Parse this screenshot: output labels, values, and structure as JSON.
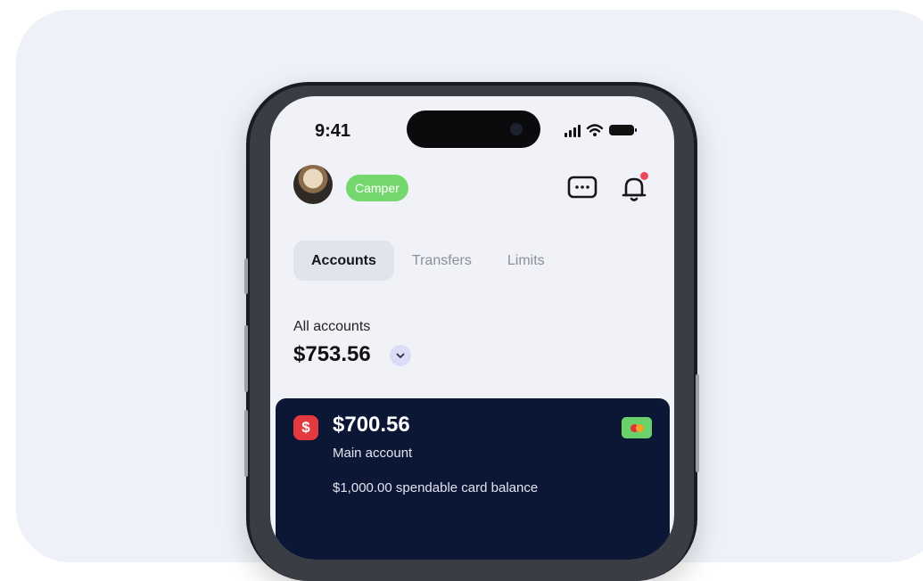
{
  "status_bar": {
    "time": "9:41"
  },
  "header": {
    "badge_label": "Camper"
  },
  "tabs": [
    {
      "label": "Accounts",
      "active": true
    },
    {
      "label": "Transfers",
      "active": false
    },
    {
      "label": "Limits",
      "active": false
    }
  ],
  "summary": {
    "label": "All accounts",
    "total": "$753.56"
  },
  "account_card": {
    "currency_symbol": "$",
    "balance": "$700.56",
    "name": "Main account",
    "spendable": "$1,000.00 spendable card balance"
  },
  "icons": {
    "messages": "message-dots-icon",
    "notifications": "bell-icon",
    "dropdown": "chevron-down-icon",
    "card": "mastercard-icon"
  },
  "colors": {
    "background": "#eff1f8",
    "badge": "#74d86f",
    "card": "#0c1635",
    "notification_dot": "#f0465b",
    "currency_badge": "#e43a3f"
  }
}
